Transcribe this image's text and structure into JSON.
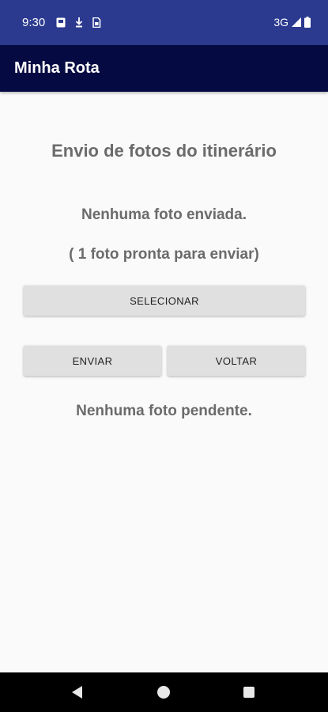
{
  "status_bar": {
    "time": "9:30",
    "network": "3G",
    "icons": [
      "notification-icon",
      "download-icon",
      "sim-icon",
      "signal-icon",
      "battery-icon"
    ]
  },
  "app_bar": {
    "title": "Minha Rota"
  },
  "main": {
    "heading": "Envio de fotos do itinerário",
    "sent_status": "Nenhuma foto enviada.",
    "ready_status": "( 1 foto pronta para enviar)",
    "select_label": "SELECIONAR",
    "send_label": "ENVIAR",
    "back_label": "VOLTAR",
    "pending_status": "Nenhuma foto pendente."
  },
  "nav_bar": {
    "icons": [
      "back-icon",
      "home-icon",
      "recents-icon"
    ]
  },
  "colors": {
    "status_bar": "#2b3a8f",
    "app_bar": "#050a42",
    "background": "#fafafa",
    "button": "#e0e0e0",
    "text": "#6b6b6b"
  }
}
